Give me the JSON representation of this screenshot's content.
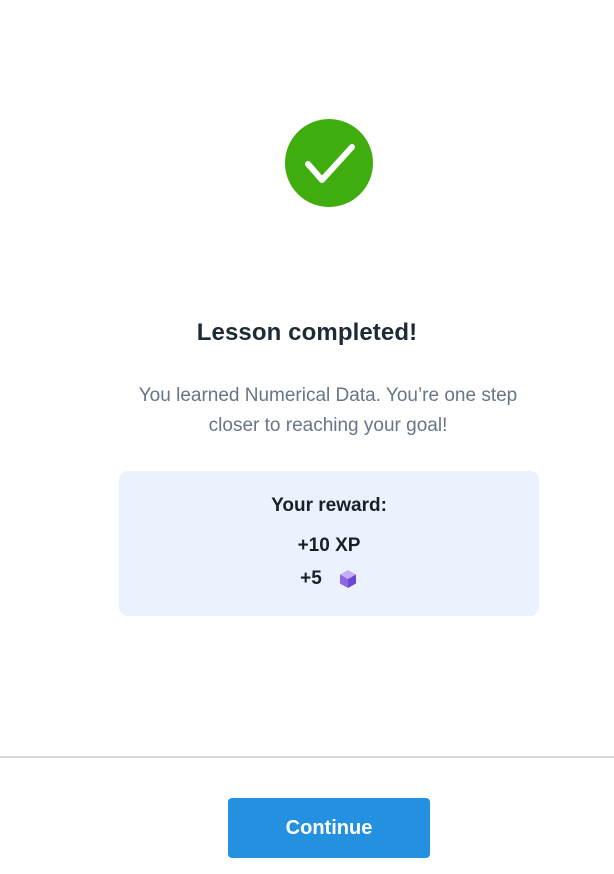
{
  "status": {
    "icon": "checkmark-circle-icon",
    "accent_color": "#3fad0d"
  },
  "completion": {
    "title": "Lesson completed!",
    "message": "You learned Numerical Data. You’re one step closer to reaching your goal!"
  },
  "reward": {
    "title": "Your reward:",
    "xp": "+10 XP",
    "gems": "+5",
    "gem_icon": "gem-icon",
    "background_color": "#ebf2fd"
  },
  "footer": {
    "continue_label": "Continue",
    "button_color": "#2391e0"
  }
}
